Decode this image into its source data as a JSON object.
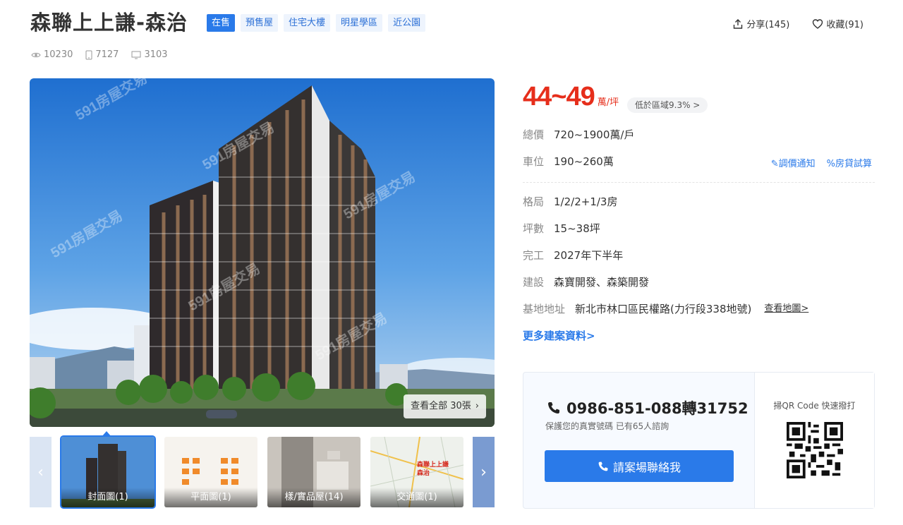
{
  "title": "森聯上上謙-森治",
  "tags": [
    "在售",
    "預售屋",
    "住宅大樓",
    "明星學區",
    "近公園"
  ],
  "actions": {
    "share": "分享(145)",
    "favorite": "收藏(91)"
  },
  "stats": {
    "views": "10230",
    "mobile": "7127",
    "desktop": "3103"
  },
  "gallery": {
    "watermark": "591房屋交易",
    "view_all": "查看全部 30張",
    "thumbs": [
      "封面圖(1)",
      "平面圖(1)",
      "樣/實品屋(14)",
      "交通圖(1)"
    ],
    "map_label_line1": "森聯上上謙",
    "map_label_line2": "森治"
  },
  "price": {
    "value": "44~49",
    "unit": "萬/坪",
    "compare": "低於區域9.3% >"
  },
  "info": [
    {
      "label": "總價",
      "value": "720~1900萬/戶"
    },
    {
      "label": "車位",
      "value": "190~260萬"
    },
    {
      "label": "格局",
      "value": "1/2/2+1/3房"
    },
    {
      "label": "坪數",
      "value": "15~38坪"
    },
    {
      "label": "完工",
      "value": "2027年下半年"
    },
    {
      "label": "建設",
      "value": "森寶開發、森築開發"
    },
    {
      "label": "基地地址",
      "value": "新北市林口區民權路(力行段338地號)"
    }
  ],
  "links": {
    "price_alert": "調價通知",
    "mortgage": "房貸試算",
    "map": "查看地圖>",
    "more": "更多建案資料>"
  },
  "contact": {
    "phone": "0986-851-088轉31752",
    "note": "保護您的真實號碼 已有65人諮詢",
    "button": "請案場聯絡我",
    "qr_label": "掃QR Code 快速撥打"
  },
  "colors": {
    "accent": "#2a7ae9",
    "price": "#e62e1b"
  }
}
